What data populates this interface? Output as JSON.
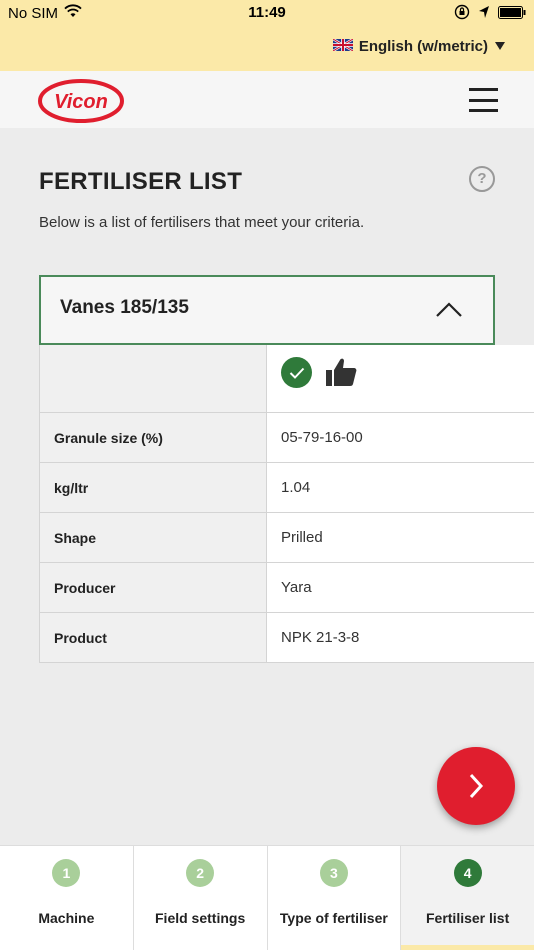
{
  "status_bar": {
    "carrier": "No SIM",
    "time": "11:49"
  },
  "language": {
    "label": "English (w/metric)"
  },
  "brand": {
    "logo_text": "Vicon",
    "logo_color": "#e01e2e"
  },
  "page": {
    "title": "FERTILISER LIST",
    "subtitle": "Below is a list of fertilisers that meet your criteria."
  },
  "accordion": {
    "title": "Vanes 185/135"
  },
  "table": {
    "rows": [
      {
        "label": "Granule size (%)",
        "value": "05-79-16-00"
      },
      {
        "label": "kg/ltr",
        "value": "1.04"
      },
      {
        "label": "Shape",
        "value": "Prilled"
      },
      {
        "label": "Producer",
        "value": "Yara"
      },
      {
        "label": "Product",
        "value": "NPK 21-3-8"
      }
    ]
  },
  "steps": [
    {
      "number": "1",
      "label": "Machine"
    },
    {
      "number": "2",
      "label": "Field settings"
    },
    {
      "number": "3",
      "label": "Type of fertiliser"
    },
    {
      "number": "4",
      "label": "Fertiliser list"
    }
  ],
  "colors": {
    "accent_green": "#2f7a3a",
    "light_green": "#a9cf9a",
    "banner_yellow": "#fbe9a8",
    "fab_red": "#e01e2e"
  }
}
